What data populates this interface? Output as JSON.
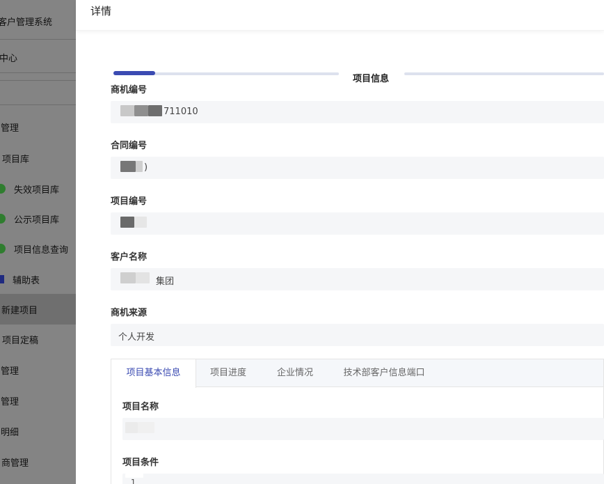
{
  "sidebar": {
    "items": [
      {
        "label": "客户管理系统"
      },
      {
        "label": "中心"
      },
      {
        "label": "管理"
      },
      {
        "label": "项目库"
      },
      {
        "label": "失效项目库"
      },
      {
        "label": "公示项目库"
      },
      {
        "label": "项目信息查询"
      },
      {
        "label": "辅助表"
      },
      {
        "label": "新建项目"
      },
      {
        "label": "项目定稿"
      },
      {
        "label": "管理"
      },
      {
        "label": "管理"
      },
      {
        "label": "明细"
      },
      {
        "label": "商管理"
      }
    ]
  },
  "drawer": {
    "title": "详情",
    "section_title": "项目信息",
    "fields": [
      {
        "label": "商机编号",
        "value": "711010"
      },
      {
        "label": "合同编号",
        "value": ")"
      },
      {
        "label": "项目编号",
        "value": ""
      },
      {
        "label": "客户名称",
        "value": "集团"
      },
      {
        "label": "商机来源",
        "value": "个人开发"
      }
    ],
    "tabs": [
      {
        "label": "项目基本信息"
      },
      {
        "label": "项目进度"
      },
      {
        "label": "企业情况"
      },
      {
        "label": "技术部客户信息端口"
      }
    ],
    "tab_fields": [
      {
        "label": "项目名称",
        "value": ""
      },
      {
        "label": "项目条件",
        "value": "1"
      }
    ]
  },
  "colors": {
    "accent": "#3b4bb2",
    "field_bg": "#f5f6f8",
    "sidebar_dim": "#848484"
  }
}
